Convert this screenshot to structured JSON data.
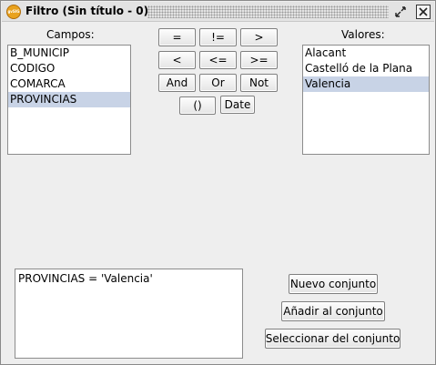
{
  "window": {
    "title": "Filtro (Sin título - 0)",
    "app_icon_text": "gvSIG"
  },
  "campos": {
    "label": "Campos:",
    "items": [
      "B_MUNICIP",
      "CODIGO",
      "COMARCA",
      "PROVINCIAS"
    ],
    "selected_index": 3
  },
  "valores": {
    "label": "Valores:",
    "items": [
      "Alacant",
      "Castelló de la Plana",
      "Valencia"
    ],
    "selected_index": 2
  },
  "operators": {
    "eq": "=",
    "neq": "!=",
    "gt": ">",
    "lt": "<",
    "lte": "<=",
    "gte": ">=",
    "and": "And",
    "or": "Or",
    "not": "Not",
    "parens": "()",
    "date": "Date"
  },
  "expression": {
    "value": "PROVINCIAS = 'Valencia'"
  },
  "actions": {
    "new_set": "Nuevo conjunto",
    "add_to_set": "Añadir al conjunto",
    "select_from_set": "Seleccionar del conjunto"
  },
  "colors": {
    "selection": "#c8d3e6",
    "window_bg": "#eeeeee"
  }
}
